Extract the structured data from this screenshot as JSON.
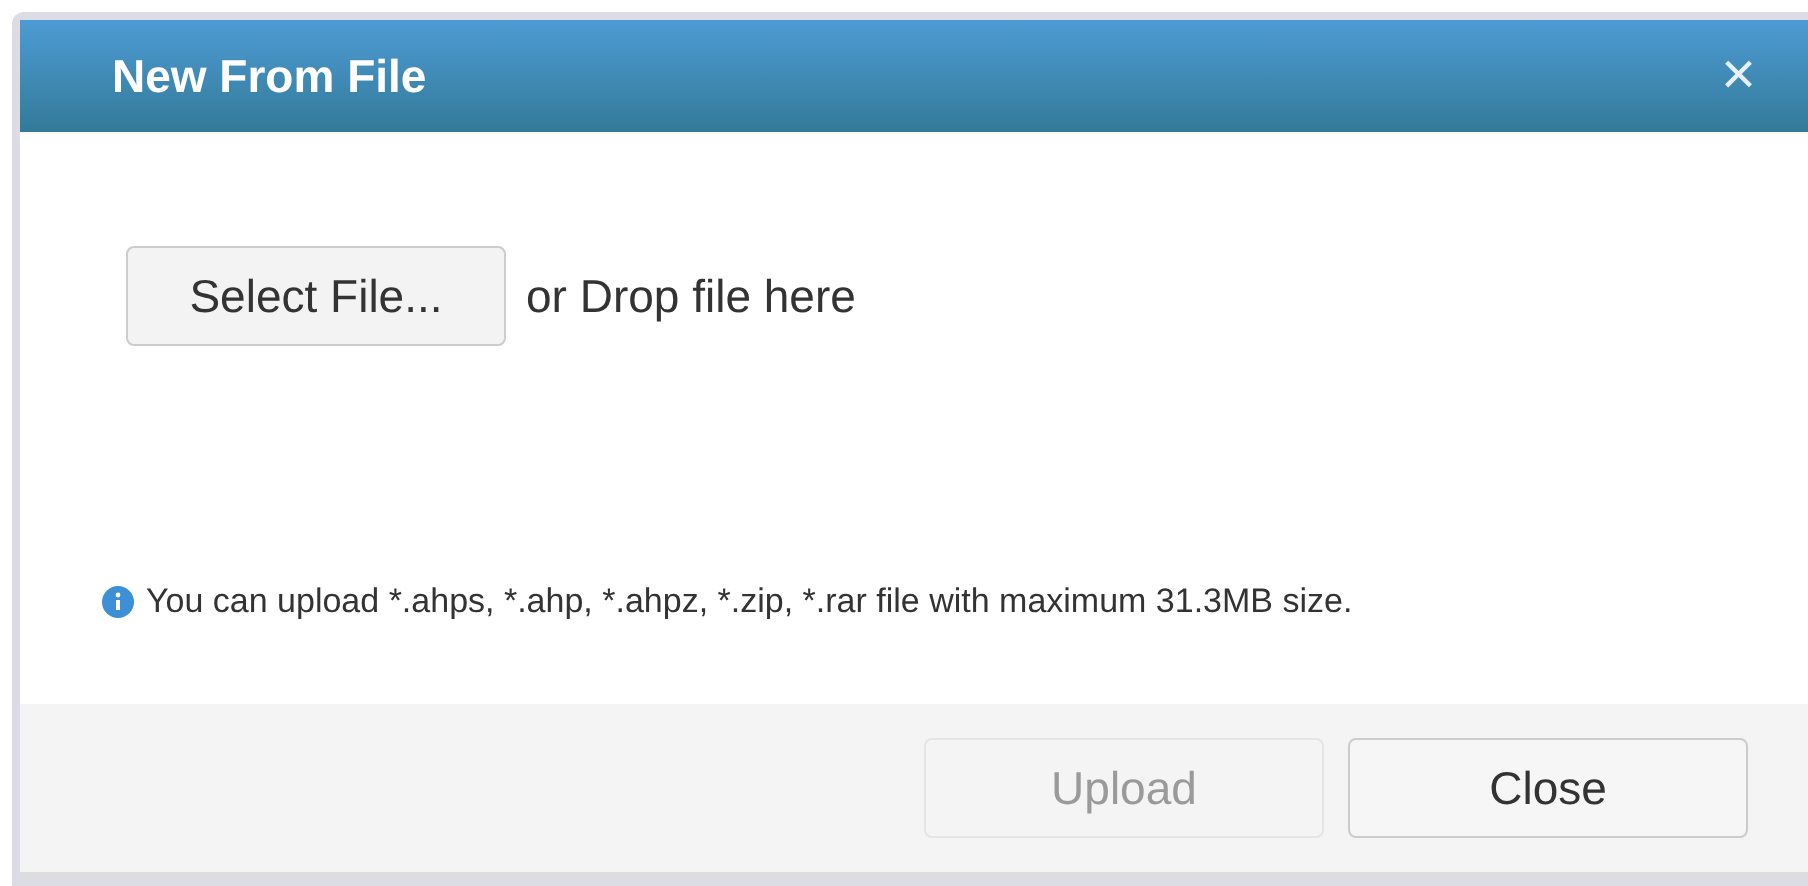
{
  "window": {
    "title": "New From File",
    "close": "×"
  },
  "select_button": {
    "label": "Select File..."
  },
  "drop_hint": "or Drop file here",
  "info": "You can upload *.ahps, *.ahp, *.ahpz, *.zip, *.rar file with maximum 31.3MB size.",
  "buttons": [
    {
      "label": "Upload",
      "disabled": true
    },
    {
      "label": "Close",
      "disabled": false
    }
  ]
}
